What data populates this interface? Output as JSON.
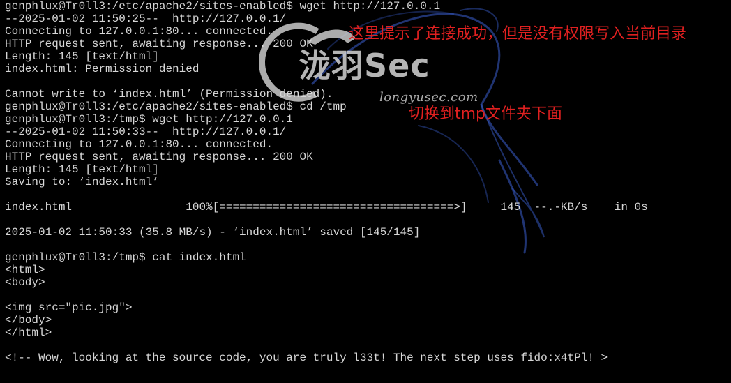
{
  "terminal": {
    "lines": [
      "genphlux@Tr0ll3:/etc/apache2/sites-enabled$ wget http://127.0.0.1",
      "--2025-01-02 11:50:25--  http://127.0.0.1/",
      "Connecting to 127.0.0.1:80... connected.",
      "HTTP request sent, awaiting response... 200 OK",
      "Length: 145 [text/html]",
      "index.html: Permission denied",
      "",
      "Cannot write to ‘index.html’ (Permission denied).",
      "genphlux@Tr0ll3:/etc/apache2/sites-enabled$ cd /tmp",
      "genphlux@Tr0ll3:/tmp$ wget http://127.0.0.1",
      "--2025-01-02 11:50:33--  http://127.0.0.1/",
      "Connecting to 127.0.0.1:80... connected.",
      "HTTP request sent, awaiting response... 200 OK",
      "Length: 145 [text/html]",
      "Saving to: ‘index.html’",
      "",
      "index.html                 100%[===================================>]     145  --.-KB/s    in 0s",
      "",
      "2025-01-02 11:50:33 (35.8 MB/s) - ‘index.html’ saved [145/145]",
      "",
      "genphlux@Tr0ll3:/tmp$ cat index.html",
      "<html>",
      "<body>",
      "",
      "<img src=\"pic.jpg\">",
      "</body>",
      "</html>",
      "",
      "<!-- Wow, looking at the source code, you are truly l33t! The next step uses fido:x4tPl! >"
    ]
  },
  "annotations": {
    "permission_note": "这里提示了连接成功，但是没有权限写入当前目录",
    "tmp_note": "切换到tmp文件夹下面"
  },
  "watermark": {
    "brand": "泷羽Sec",
    "url": "longyusec.com"
  },
  "colors": {
    "background": "#000000",
    "text": "#d6d6d6",
    "annotation": "#e02020",
    "dragon": "#3a5fd0"
  },
  "icons": {
    "background": "kali-dragon-icon",
    "watermark": "brand-logo-icon"
  }
}
